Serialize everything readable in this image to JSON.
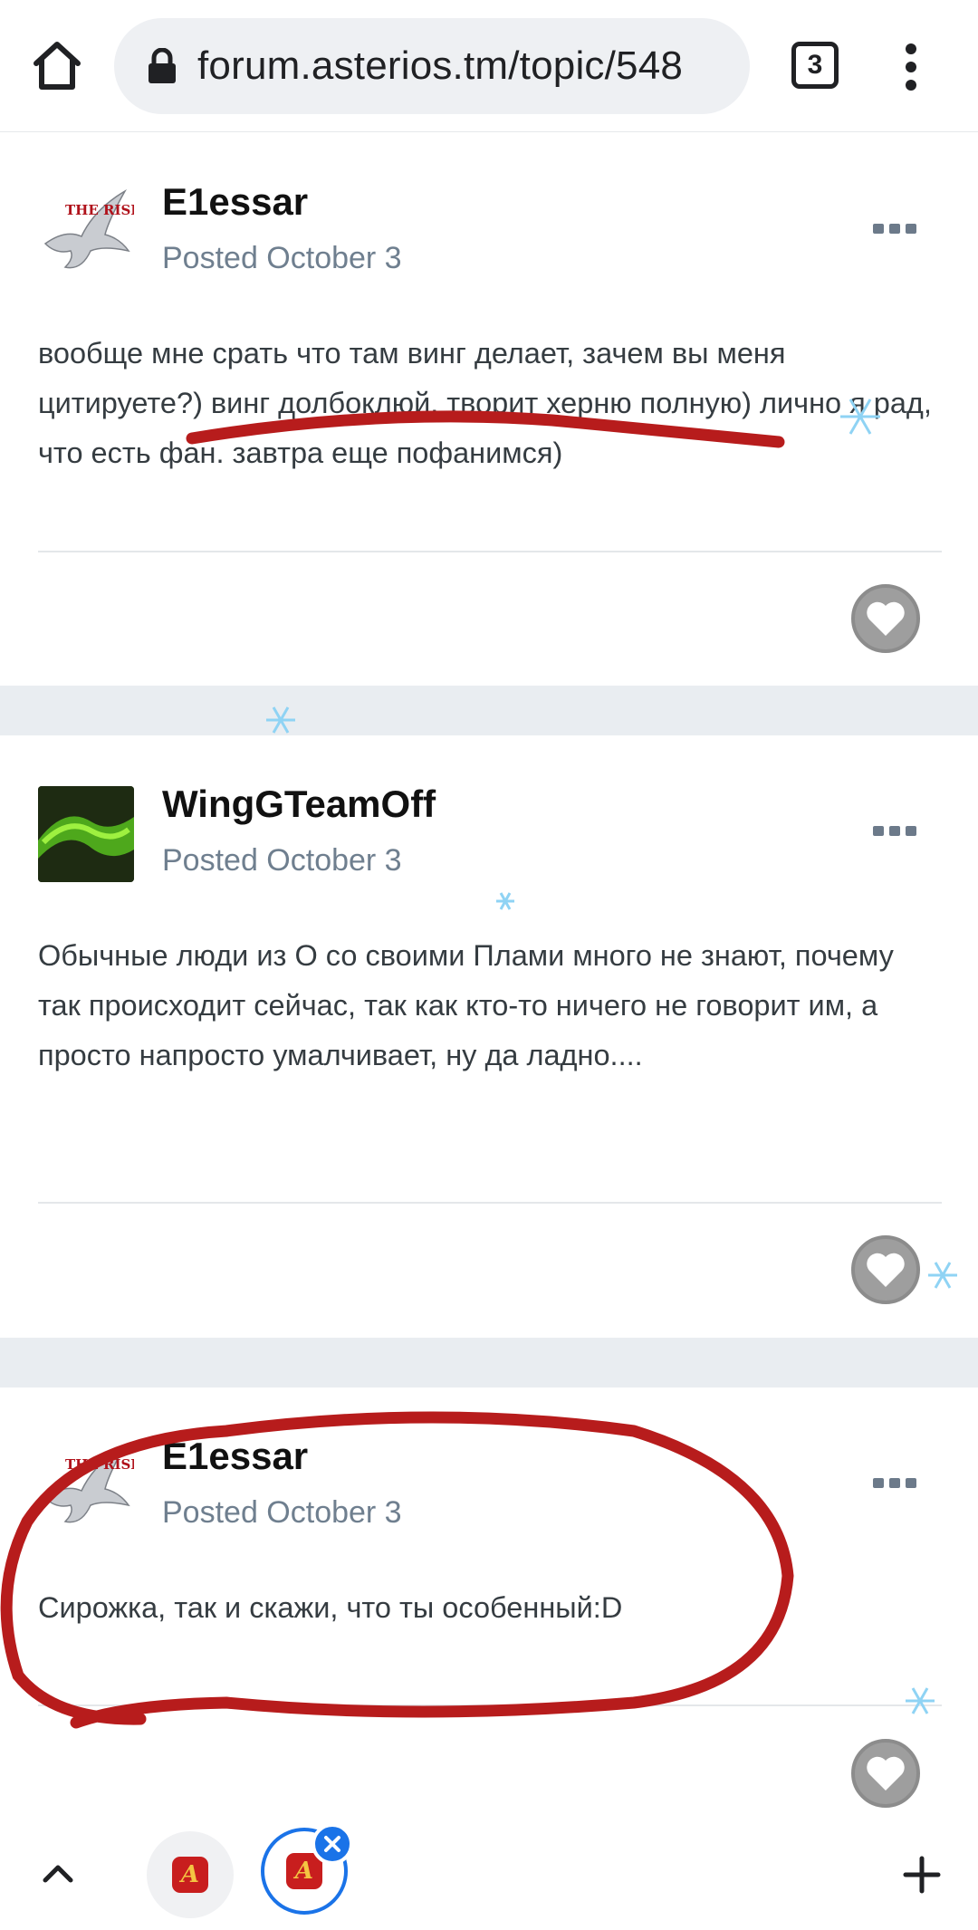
{
  "browser": {
    "url": "forum.asterios.tm/topic/548",
    "tab_count": "3",
    "icons": {
      "home": "home-icon",
      "lock": "lock-icon",
      "menu": "more-vert-icon"
    }
  },
  "posts": [
    {
      "author": "E1essar",
      "avatar_label": "THE RISE",
      "posted": "Posted October 3",
      "body": "вообще мне срать что там винг делает, зачем вы меня цитируете?) винг долбоклюй. творит херню полную) лично я рад, что есть фан. завтра еще пофанимся)"
    },
    {
      "author": "WingGTeamOff",
      "posted": "Posted October 3",
      "body": "Обычные люди из О со своими Плами много не знают, почему так происходит сейчас, так как кто-то ничего не говорит им, а просто напросто умалчивает, ну да ладно...."
    },
    {
      "author": "E1essar",
      "avatar_label": "THE RISE",
      "posted": "Posted October 3",
      "body": "Сирожка, так и скажи, что ты особенный:D"
    }
  ],
  "bottom_bar": {
    "icons": {
      "up": "chevron-up-icon",
      "close": "close-icon",
      "new_tab": "plus-icon"
    },
    "app_glyph": "A"
  },
  "colors": {
    "accent": "#1a73e8",
    "annotation": "#b71c1c",
    "gap": "#e9edf1",
    "muted_text": "#6f7f8f"
  }
}
